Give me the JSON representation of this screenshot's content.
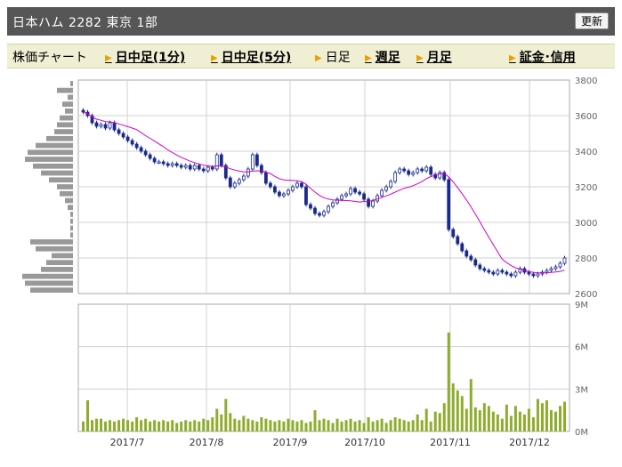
{
  "header": {
    "title": "日本ハム 2282 東京 1部",
    "refresh_label": "更新"
  },
  "tabs": {
    "label": "株価チャート",
    "items": [
      {
        "label": "日中足(1分)",
        "link": true
      },
      {
        "label": "日中足(5分)",
        "link": true
      },
      {
        "label": "日足",
        "link": false
      },
      {
        "label": "週足",
        "link": true
      },
      {
        "label": "月足",
        "link": true
      },
      {
        "label": "証金･信用",
        "link": true
      }
    ]
  },
  "chart_data": {
    "type": "candlestick",
    "x_labels": [
      "2017/7",
      "2017/8",
      "2017/9",
      "2017/10",
      "2017/11",
      "2017/12"
    ],
    "price_axis": {
      "ticks": [
        "3800",
        "3600",
        "3400",
        "3200",
        "3000",
        "2800",
        "2600"
      ],
      "ylim": [
        2600,
        3800
      ]
    },
    "volume_axis": {
      "ticks": [
        "9M",
        "6M",
        "3M",
        "0M"
      ],
      "ylim": [
        0,
        9
      ]
    },
    "colors": {
      "up": "#ffffff",
      "down": "#1a2a8c",
      "ma": "#cc00cc",
      "volume": "#8ead2c",
      "profile": "#999999",
      "grid": "#d0d0d0"
    },
    "closes": [
      3620,
      3600,
      3560,
      3540,
      3550,
      3530,
      3560,
      3520,
      3500,
      3480,
      3460,
      3440,
      3420,
      3400,
      3380,
      3360,
      3340,
      3340,
      3330,
      3320,
      3330,
      3320,
      3310,
      3320,
      3300,
      3320,
      3300,
      3290,
      3310,
      3300,
      3380,
      3320,
      3250,
      3200,
      3220,
      3240,
      3260,
      3300,
      3380,
      3320,
      3280,
      3220,
      3200,
      3170,
      3150,
      3160,
      3180,
      3200,
      3220,
      3200,
      3100,
      3080,
      3050,
      3040,
      3060,
      3090,
      3110,
      3130,
      3150,
      3160,
      3190,
      3170,
      3160,
      3130,
      3090,
      3120,
      3150,
      3180,
      3200,
      3230,
      3280,
      3300,
      3290,
      3270,
      3280,
      3300,
      3290,
      3310,
      3270,
      3250,
      3280,
      3240,
      2960,
      2920,
      2880,
      2840,
      2810,
      2790,
      2760,
      2740,
      2730,
      2720,
      2710,
      2730,
      2720,
      2710,
      2700,
      2720,
      2740,
      2720,
      2710,
      2700,
      2710,
      2720,
      2730,
      2740,
      2750,
      2770,
      2800
    ],
    "volume": [
      0.7,
      2.2,
      0.8,
      0.9,
      0.9,
      0.7,
      0.8,
      0.7,
      0.8,
      0.9,
      0.8,
      0.7,
      1.0,
      0.8,
      0.9,
      0.7,
      0.8,
      0.7,
      0.8,
      0.7,
      0.8,
      0.6,
      0.7,
      0.8,
      0.7,
      0.8,
      0.7,
      0.9,
      0.8,
      1.0,
      1.6,
      1.2,
      2.3,
      1.3,
      0.9,
      0.8,
      1.1,
      0.9,
      0.8,
      0.7,
      1.0,
      0.9,
      0.8,
      0.7,
      0.8,
      0.7,
      0.9,
      0.8,
      0.7,
      0.8,
      0.6,
      0.7,
      1.5,
      0.8,
      0.9,
      0.8,
      0.6,
      0.9,
      0.7,
      0.8,
      0.9,
      0.7,
      0.8,
      0.6,
      1.0,
      0.7,
      0.8,
      0.9,
      0.6,
      0.8,
      1.0,
      0.9,
      0.8,
      0.7,
      0.8,
      1.2,
      0.8,
      1.6,
      0.7,
      1.4,
      1.3,
      2.0,
      7.0,
      3.4,
      2.9,
      2.5,
      1.6,
      3.7,
      1.7,
      1.5,
      2.0,
      1.8,
      1.4,
      1.2,
      0.9,
      1.9,
      1.1,
      1.8,
      1.4,
      1.2,
      1.6,
      1.0,
      2.3,
      2.0,
      2.2,
      1.5,
      1.4,
      1.8,
      2.1
    ],
    "price_profile": [
      0.05,
      0.3,
      0.1,
      0.2,
      0.15,
      0.25,
      0.3,
      0.35,
      0.5,
      0.7,
      0.85,
      0.9,
      0.75,
      0.6,
      0.45,
      0.3,
      0.25,
      0.15,
      0.1,
      0.05,
      0.05,
      0.05,
      0.05,
      0.8,
      0.7,
      0.4,
      0.5,
      0.6,
      0.95,
      0.9,
      0.8
    ]
  }
}
